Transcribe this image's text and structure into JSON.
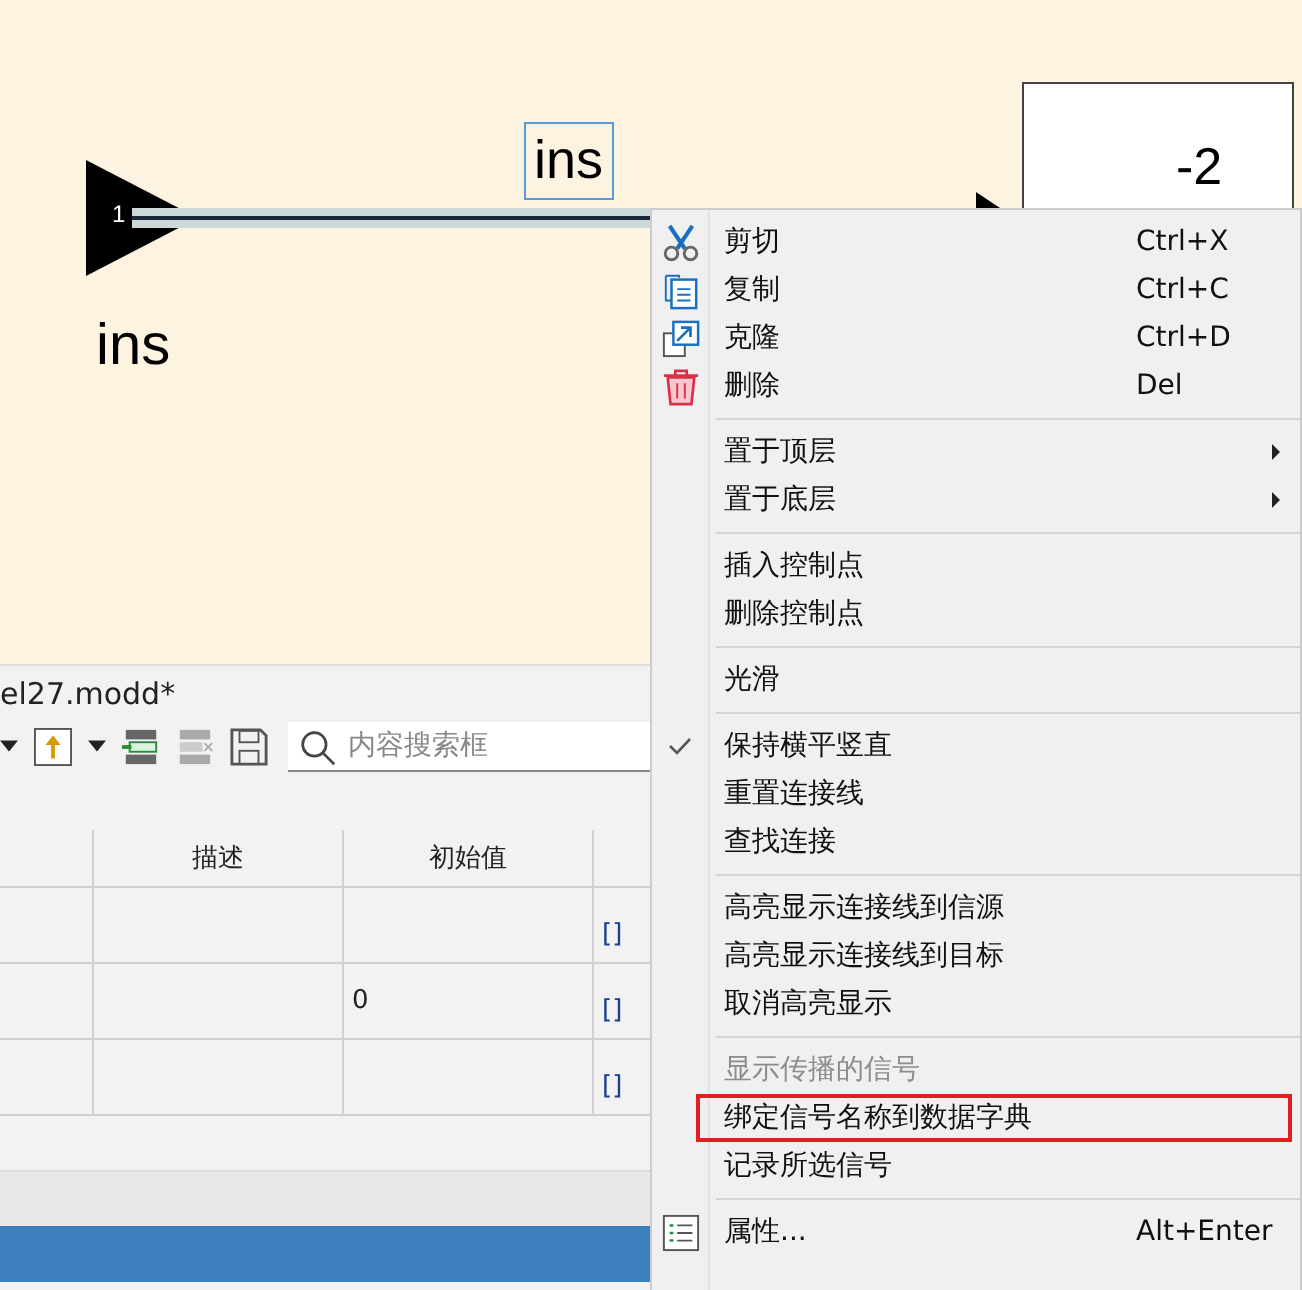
{
  "diagram": {
    "inport": {
      "number": "1",
      "name": "ins"
    },
    "signal_label": "ins",
    "delay_block": {
      "exponent": "-2"
    }
  },
  "panel": {
    "title": "el27.modd*",
    "search": {
      "placeholder": "内容搜索框"
    },
    "table": {
      "columns": [
        "描述",
        "初始值"
      ],
      "rows": [
        {
          "column_3": "",
          "column_4": "[]"
        },
        {
          "column_3": "0",
          "column_4": "[]"
        },
        {
          "column_3": "",
          "column_4": "[]"
        }
      ]
    }
  },
  "context_menu": {
    "groups": [
      [
        {
          "label": "剪切",
          "shortcut": "Ctrl+X",
          "checked": false,
          "disabled": false,
          "submenu": false,
          "highlighted": false
        },
        {
          "label": "复制",
          "shortcut": "Ctrl+C",
          "checked": false,
          "disabled": false,
          "submenu": false,
          "highlighted": false
        },
        {
          "label": "克隆",
          "shortcut": "Ctrl+D",
          "checked": false,
          "disabled": false,
          "submenu": false,
          "highlighted": false
        },
        {
          "label": "删除",
          "shortcut": "Del",
          "checked": false,
          "disabled": false,
          "submenu": false,
          "highlighted": false
        }
      ],
      [
        {
          "label": "置于顶层",
          "checked": false,
          "disabled": false,
          "submenu": true,
          "highlighted": false
        },
        {
          "label": "置于底层",
          "checked": false,
          "disabled": false,
          "submenu": true,
          "highlighted": false
        }
      ],
      [
        {
          "label": "插入控制点",
          "checked": false,
          "disabled": false,
          "submenu": false,
          "highlighted": false
        },
        {
          "label": "删除控制点",
          "checked": false,
          "disabled": false,
          "submenu": false,
          "highlighted": false
        }
      ],
      [
        {
          "label": "光滑",
          "checked": false,
          "disabled": false,
          "submenu": false,
          "highlighted": false
        }
      ],
      [
        {
          "label": "保持横平竖直",
          "checked": true,
          "disabled": false,
          "submenu": false,
          "highlighted": false
        },
        {
          "label": "重置连接线",
          "checked": false,
          "disabled": false,
          "submenu": false,
          "highlighted": false
        },
        {
          "label": "查找连接",
          "checked": false,
          "disabled": false,
          "submenu": false,
          "highlighted": false
        }
      ],
      [
        {
          "label": "高亮显示连接线到信源",
          "checked": false,
          "disabled": false,
          "submenu": false,
          "highlighted": false
        },
        {
          "label": "高亮显示连接线到目标",
          "checked": false,
          "disabled": false,
          "submenu": false,
          "highlighted": false
        },
        {
          "label": "取消高亮显示",
          "checked": false,
          "disabled": false,
          "submenu": false,
          "highlighted": false
        }
      ],
      [
        {
          "label": "显示传播的信号",
          "checked": false,
          "disabled": true,
          "submenu": false,
          "highlighted": false
        },
        {
          "label": "绑定信号名称到数据字典",
          "checked": false,
          "disabled": false,
          "submenu": false,
          "highlighted": true
        },
        {
          "label": "记录所选信号",
          "checked": false,
          "disabled": false,
          "submenu": false,
          "highlighted": false
        }
      ],
      [
        {
          "label": "属性...",
          "shortcut": "Alt+Enter",
          "checked": false,
          "disabled": false,
          "submenu": false,
          "highlighted": false
        }
      ]
    ]
  }
}
